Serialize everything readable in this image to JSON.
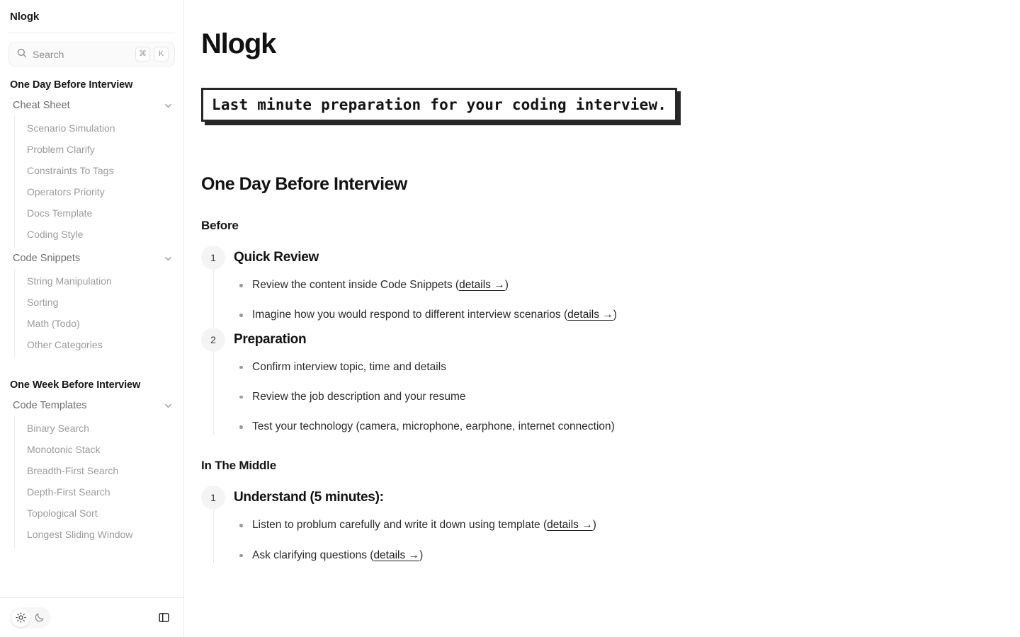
{
  "app": {
    "brand": "Nlogk"
  },
  "sidebar": {
    "search": {
      "placeholder": "Search",
      "kbd_mod": "⌘",
      "kbd_key": "K"
    },
    "groups": [
      {
        "title": "One Day Before Interview",
        "sections": [
          {
            "label": "Cheat Sheet",
            "expanded": true,
            "items": [
              "Scenario Simulation",
              "Problem Clarify",
              "Constraints To Tags",
              "Operators Priority",
              "Docs Template",
              "Coding Style"
            ]
          },
          {
            "label": "Code Snippets",
            "expanded": true,
            "items": [
              "String Manipulation",
              "Sorting",
              "Math (Todo)",
              "Other Categories"
            ]
          }
        ]
      },
      {
        "title": "One Week Before Interview",
        "sections": [
          {
            "label": "Code Templates",
            "expanded": true,
            "items": [
              "Binary Search",
              "Monotonic Stack",
              "Breadth-First Search",
              "Depth-First Search",
              "Topological Sort",
              "Longest Sliding Window"
            ]
          }
        ]
      }
    ],
    "footer": {
      "theme_light": "sun-icon",
      "theme_dark": "moon-icon",
      "panel_toggle": "sidebar-panel-icon",
      "active_theme": "light"
    }
  },
  "main": {
    "title": "Nlogk",
    "banner": "Last minute preparation for your coding interview.",
    "section_heading": "One Day Before Interview",
    "blocks": [
      {
        "subheading": "Before",
        "steps": [
          {
            "number": "1",
            "title": "Quick Review",
            "bullets": [
              {
                "pre": "Review the content inside Code Snippets (",
                "link": "details →",
                "post": ")"
              },
              {
                "pre": "Imagine how you would respond to different interview scenarios (",
                "link": "details →",
                "post": ")"
              }
            ]
          },
          {
            "number": "2",
            "title": "Preparation",
            "bullets": [
              {
                "pre": "Confirm interview topic, time and details",
                "link": "",
                "post": ""
              },
              {
                "pre": "Review the job description and your resume",
                "link": "",
                "post": ""
              },
              {
                "pre": "Test your technology (camera, microphone, earphone, internet connection)",
                "link": "",
                "post": ""
              }
            ]
          }
        ]
      },
      {
        "subheading": "In The Middle",
        "steps": [
          {
            "number": "1",
            "title": "Understand (5 minutes):",
            "bullets": [
              {
                "pre": "Listen to problum carefully and write it down using template (",
                "link": "details →",
                "post": ")"
              },
              {
                "pre": "Ask clarifying questions (",
                "link": "details →",
                "post": ")"
              }
            ]
          }
        ]
      }
    ]
  },
  "colors": {
    "accent": "#272727",
    "text": "#121212",
    "muted": "#9b9b9b",
    "border": "#ececec"
  }
}
